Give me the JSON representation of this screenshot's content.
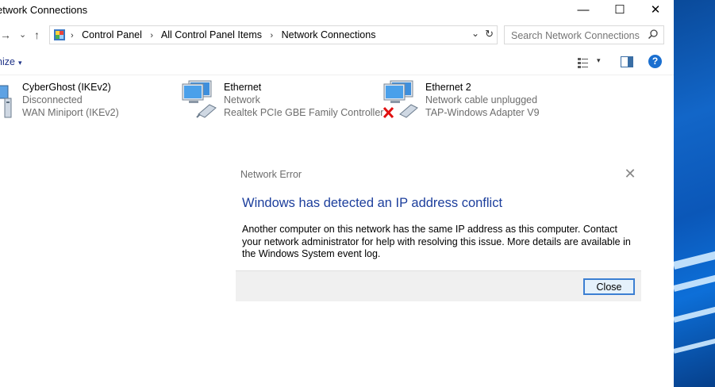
{
  "window": {
    "title": "etwork Connections",
    "controls": {
      "minimize": "—",
      "maximize": "☐",
      "close": "✕"
    }
  },
  "nav": {
    "forward": "→",
    "recent": "⌄",
    "up": "↑"
  },
  "address": {
    "breadcrumbs": [
      "Control Panel",
      "All Control Panel Items",
      "Network Connections"
    ],
    "separator": "›",
    "dropdown": "⌄",
    "refresh": "↻"
  },
  "search": {
    "placeholder": "Search Network Connections",
    "icon": "search-icon"
  },
  "command_bar": {
    "organize_label": "nize",
    "caret": "▾",
    "help_label": "?"
  },
  "connections": [
    {
      "name": "CyberGhost (IKEv2)",
      "status": "Disconnected",
      "device": "WAN Miniport (IKEv2)"
    },
    {
      "name": "Ethernet",
      "status": "Network",
      "device": "Realtek PCIe GBE Family Controller"
    },
    {
      "name": "Ethernet 2",
      "status": "Network cable unplugged",
      "device": "TAP-Windows Adapter V9"
    }
  ],
  "dialog": {
    "title": "Network Error",
    "close_glyph": "✕",
    "heading": "Windows has detected an IP address conflict",
    "body": "Another computer on this network has the same IP address as this computer. Contact your network administrator for help with resolving this issue. More details are available in the Windows System event log.",
    "button_label": "Close"
  },
  "colors": {
    "heading_blue": "#1c3e9c",
    "link_blue": "#1e3287",
    "button_border": "#3c7fd2",
    "desktop_blue": "#1266c8",
    "error_red": "#e01010"
  }
}
